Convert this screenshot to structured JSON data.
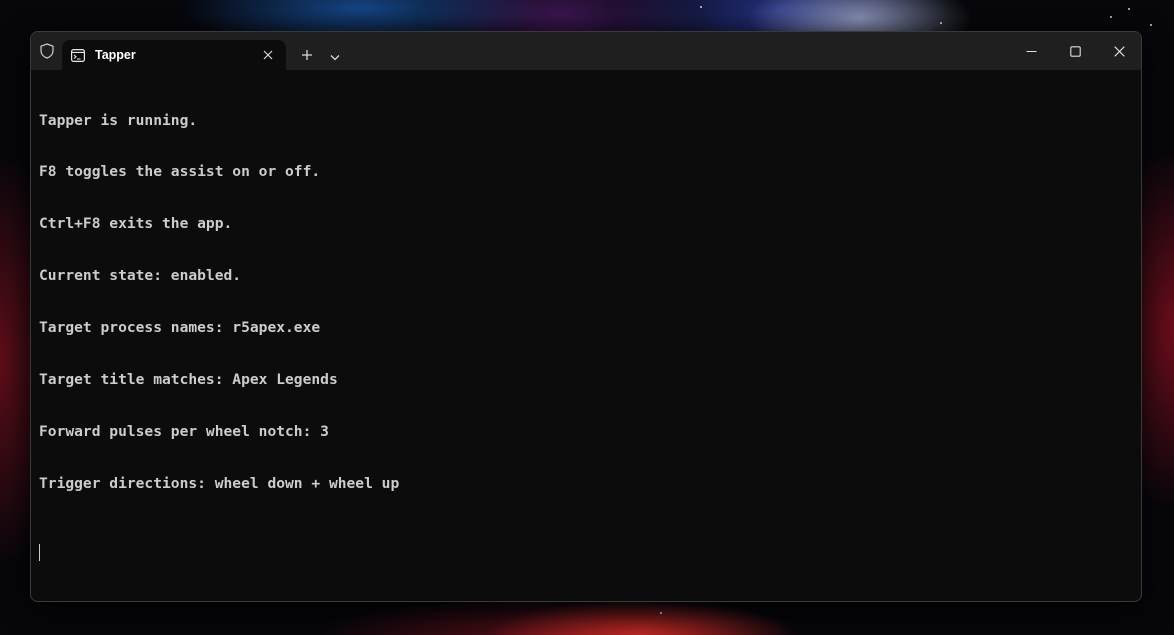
{
  "window": {
    "tab_title": "Tapper"
  },
  "terminal": {
    "lines": [
      "Tapper is running.",
      "F8 toggles the assist on or off.",
      "Ctrl+F8 exits the app.",
      "Current state: enabled.",
      "Target process names: r5apex.exe",
      "Target title matches: Apex Legends",
      "Forward pulses per wheel notch: 3",
      "Trigger directions: wheel down + wheel up"
    ]
  },
  "icons": {
    "shield": "shield-icon",
    "tab": "terminal-icon",
    "close_tab": "close-icon",
    "new_tab": "plus-icon",
    "dropdown": "chevron-down-icon",
    "minimize": "minimize-icon",
    "maximize": "maximize-icon",
    "close_window": "close-icon"
  },
  "colors": {
    "terminal_bg": "#0c0c0c",
    "titlebar_bg": "#1f1f1f",
    "text": "#cccccc"
  }
}
